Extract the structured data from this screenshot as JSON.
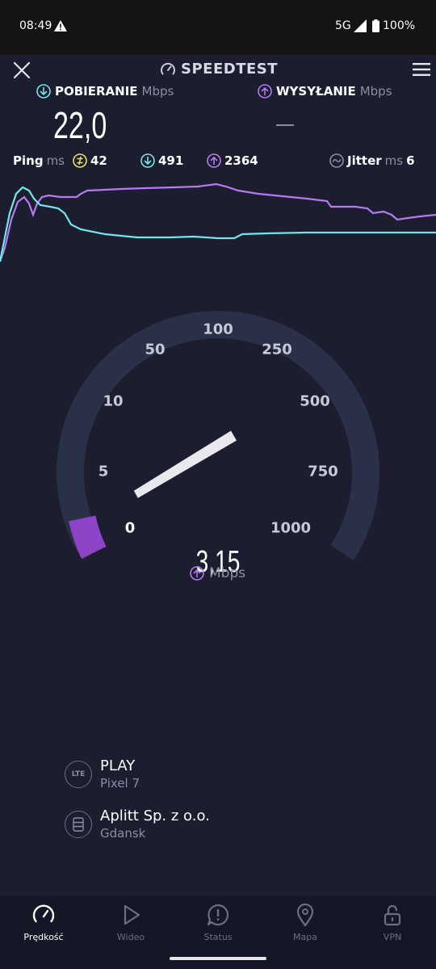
{
  "status_bar": {
    "time": "08:49",
    "network": "5G",
    "battery": "100%"
  },
  "header": {
    "title": "SPEEDTEST"
  },
  "download": {
    "label": "POBIERANIE",
    "unit": "Mbps",
    "value": "22,0"
  },
  "upload": {
    "label": "WYSYŁANIE",
    "unit": "Mbps",
    "value": "—"
  },
  "metrics": {
    "ping_label": "Ping",
    "ping_unit": "ms",
    "ping_idle": "42",
    "ping_download": "491",
    "ping_upload": "2364",
    "jitter_label": "Jitter",
    "jitter_unit": "ms",
    "jitter_value": "6"
  },
  "gauge": {
    "ticks": [
      "0",
      "5",
      "10",
      "50",
      "100",
      "250",
      "500",
      "750",
      "1000"
    ],
    "value": "3,15",
    "unit": "Mbps",
    "accent": "#8e44c9"
  },
  "providers": [
    {
      "name": "PLAY",
      "sub": "Pixel 7",
      "icon": "lte-icon"
    },
    {
      "name": "Aplitt Sp. z o.o.",
      "sub": "Gdansk",
      "icon": "server-icon"
    }
  ],
  "nav": [
    {
      "label": "Prędkość",
      "icon": "speedometer-icon",
      "active": true
    },
    {
      "label": "Wideo",
      "icon": "play-icon",
      "active": false
    },
    {
      "label": "Status",
      "icon": "alert-bubble-icon",
      "active": false
    },
    {
      "label": "Mapa",
      "icon": "map-pin-icon",
      "active": false
    },
    {
      "label": "VPN",
      "icon": "unlock-icon",
      "active": false
    }
  ],
  "colors": {
    "download": "#72e6e8",
    "upload": "#b57bf0",
    "idle": "#e8e26a",
    "background": "#1c1e30"
  }
}
